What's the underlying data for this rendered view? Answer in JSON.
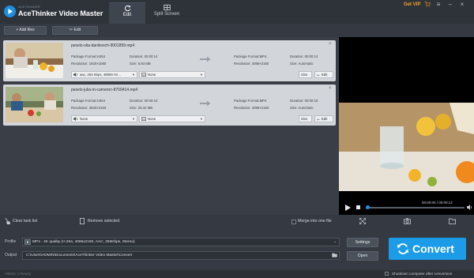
{
  "app": {
    "brand_small": "ACETHINKER",
    "title": "AceThinker Video Master",
    "get_vip": "Get VIP"
  },
  "tabs": [
    {
      "label": "Edit",
      "icon": "refresh-icon",
      "active": true
    },
    {
      "label": "Split Screen",
      "icon": "split-screen-icon",
      "active": false
    }
  ],
  "toolbar": {
    "add_files": "+ Add files",
    "edit": "Edit"
  },
  "files": [
    {
      "name": "pexels-olia-danilevich-9001899.mp4",
      "src_format": "Package Format:H264",
      "src_duration": "Duration: 00:00:14",
      "src_resolution": "Resolution: 1920×1080",
      "src_size": "Size: 8.83 MB",
      "dst_format": "Package Format:MP4",
      "dst_duration": "Duration: 00:00:14",
      "dst_resolution": "Resolution: 4096×2160",
      "dst_size": "Size: Automatic",
      "audio": "aac, 253 Kbps, 48000 Hz...",
      "subtitle": "None",
      "size_btn": "Size",
      "edit_btn": "Edit"
    },
    {
      "name": "pexels-julia-m-cameron-8769414.mp4",
      "src_format": "Package Format:H264",
      "src_duration": "Duration: 00:00:10",
      "src_resolution": "Resolution: 3840×2160",
      "src_size": "Size: 25.32 MB",
      "dst_format": "Package Format:MP4",
      "dst_duration": "Duration: 00:00:10",
      "dst_resolution": "Resolution: 4096×2160",
      "dst_size": "Size: Automatic",
      "audio": "None",
      "subtitle": "None",
      "size_btn": "Size",
      "edit_btn": "Edit"
    }
  ],
  "player": {
    "timecode": "00:00:00 / 00:00:14",
    "progress": 0
  },
  "bottom": {
    "clear_task_list": "Clear task list",
    "remove_selected": "Remove selected",
    "merge": "Merge into one file"
  },
  "output": {
    "profile_label": "Profile",
    "profile_value": "MP4 - 4K quality (H.264, 4096x2160, AAC, 256Kbps, Stereo)",
    "output_label": "Output",
    "output_value": "C:\\Users\\ADMIN\\Documents\\AceThinker Video Master\\Convert",
    "settings": "Settings",
    "open": "Open",
    "convert": "Convert"
  },
  "status": {
    "left": "Videos: 2    Ready",
    "shutdown": "Shutdown computer after conversion"
  },
  "colors": {
    "accent": "#1c9be8",
    "vip": "#f7a31c"
  }
}
